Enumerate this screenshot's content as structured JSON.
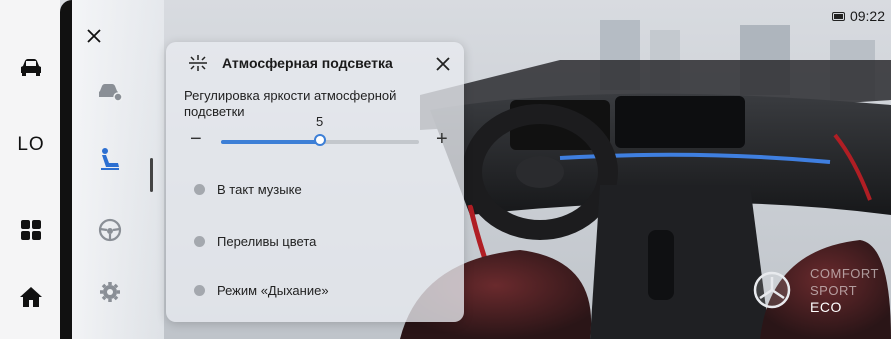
{
  "status": {
    "time": "09:22",
    "icon": "battery-icon"
  },
  "dock": {
    "items": [
      {
        "icon": "car-icon"
      },
      {
        "label": "LO"
      },
      {
        "icon": "apps-grid-icon"
      },
      {
        "icon": "home-icon"
      }
    ]
  },
  "categories": {
    "close_icon": "close-icon",
    "items": [
      {
        "icon": "vehicle-settings-icon"
      },
      {
        "icon": "seat-icon"
      },
      {
        "icon": "steering-wheel-icon"
      },
      {
        "icon": "gear-icon"
      }
    ]
  },
  "ambient_panel": {
    "title": "Атмосферная подсветка",
    "title_icon": "ambient-light-icon",
    "brightness_label": "Регулировка яркости атмосферной подсветки",
    "brightness": {
      "value": "5",
      "level": 0.5,
      "minus": "−",
      "plus": "+"
    },
    "options": [
      {
        "label": "В такт музыке"
      },
      {
        "label": "Переливы цвета"
      },
      {
        "label": "Режим «Дыхание»"
      }
    ]
  },
  "drive_modes": {
    "items": [
      "COMFORT",
      "SPORT",
      "ECO"
    ],
    "active": "ECO"
  },
  "colors": {
    "accent": "#3d7fd6",
    "ambient_strip": "#3f7fe0",
    "dashboard_red": "#b01e24"
  }
}
